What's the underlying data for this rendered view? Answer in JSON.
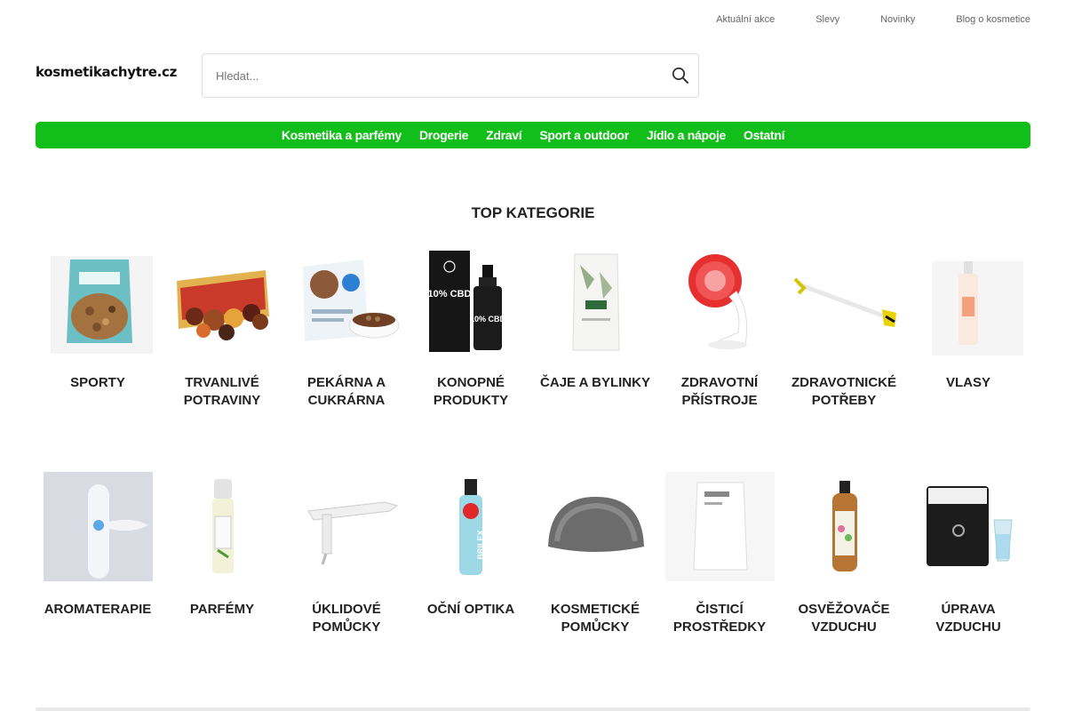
{
  "top_links": [
    "Aktuální akce",
    "Slevy",
    "Novinky",
    "Blog o kosmetice"
  ],
  "logo": "kosmetikachytre.cz",
  "search": {
    "placeholder": "Hledat..."
  },
  "nav": [
    "Kosmetika a parfémy",
    "Drogerie",
    "Zdraví",
    "Sport a outdoor",
    "Jídlo a nápoje",
    "Ostatní"
  ],
  "section_title": "TOP KATEGORIE",
  "categories_row1": [
    "SPORTY",
    "TRVANLIVÉ POTRAVINY",
    "PEKÁRNA A CUKRÁRNA",
    "KONOPNÉ PRODUKTY",
    "ČAJE A BYLINKY",
    "ZDRAVOTNÍ PŘÍSTROJE",
    "ZDRAVOTNICKÉ POTŘEBY",
    "VLASY"
  ],
  "categories_row2": [
    "AROMATERAPIE",
    "PARFÉMY",
    "ÚKLIDOVÉ POMŮCKY",
    "OČNÍ OPTIKA",
    "KOSMETICKÉ POMŮCKY",
    "ČISTICÍ PROSTŘEDKY",
    "OSVĚŽOVAČE VZDUCHU",
    "ÚPRAVA VZDUCHU"
  ],
  "product_text": {
    "cbd_label": "10% CBD",
    "brilex": "BRILEX"
  },
  "colors": {
    "nav_bg": "#12be1a",
    "nav_text": "#ffffff"
  },
  "icons": {
    "search": "search-icon"
  }
}
